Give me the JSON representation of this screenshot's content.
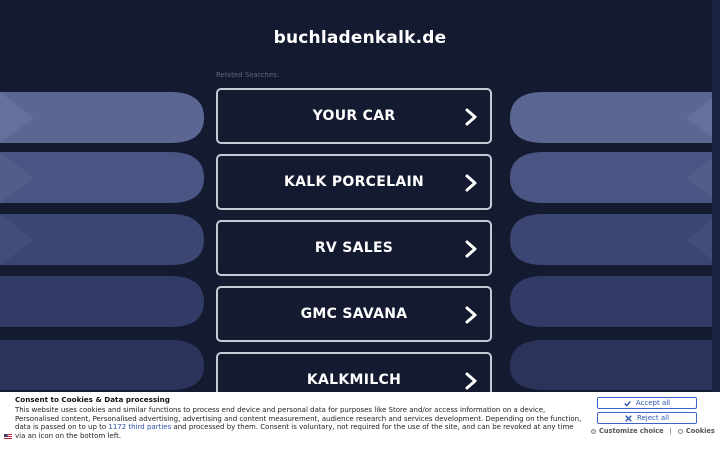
{
  "site": {
    "title": "buchladenkalk.de",
    "related_label": "Related Searches:"
  },
  "links": [
    {
      "label": "YOUR CAR"
    },
    {
      "label": "KALK PORCELAIN"
    },
    {
      "label": "RV SALES"
    },
    {
      "label": "GMC SAVANA"
    },
    {
      "label": "KALKMILCH"
    }
  ],
  "consent": {
    "title": "Consent to Cookies & Data processing",
    "text_part1": "This website uses cookies and similar functions to process end device and personal data for purposes like Store and/or access information on a device, Personalised content, Personalised advertising, advertising and content measurement, audience research and services development. Depending on the function, data is passed on to up to ",
    "third_parties_link": "1172 third parties",
    "text_part2": " and processed by them. Consent is voluntary, not required for the use of the site, and can be revoked at any time via an icon on the bottom left.",
    "accept_label": "Accept all",
    "reject_label": "Reject all",
    "customize_label": "Customize choice",
    "separator": "|",
    "cookies_label": "Cookies"
  },
  "colors": {
    "background": "#141a30",
    "button_border": "#c7cad4",
    "consent_accent": "#3c63c8"
  }
}
